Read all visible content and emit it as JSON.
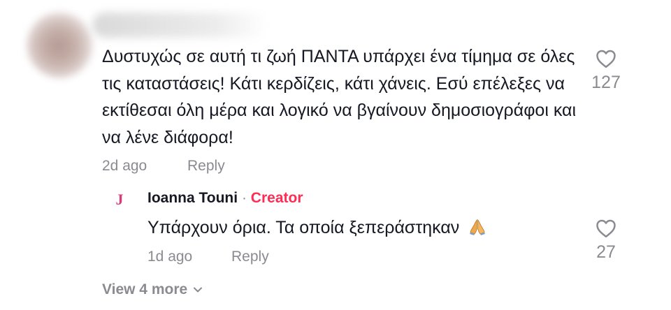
{
  "comment": {
    "text": "Δυστυχώς σε αυτή τι ζωή ΠΑΝΤΑ υπάρχει ένα τίμημα σε όλες τις καταστάσεις! Κάτι κερδίζεις, κάτι χάνεις. Εσύ επέλεξες να εκτίθεσαι όλη μέρα και λογικό να βγαίνουν δημοσιογράφοι και να λένε διάφορα!",
    "time": "2d ago",
    "reply_label": "Reply",
    "like_count": "127",
    "like_icon": "heart-outline-icon"
  },
  "reply": {
    "avatar_letter": "J",
    "author": "Ioanna Touni",
    "separator": "·",
    "badge": "Creator",
    "text": "Υπάρχουν όρια. Τα οποία ξεπεράστηκαν",
    "emoji_icon": "folded-hands-icon",
    "time": "1d ago",
    "reply_label": "Reply",
    "like_count": "27",
    "like_icon": "heart-outline-icon"
  },
  "view_more": {
    "label": "View 4 more",
    "icon": "chevron-down-icon"
  },
  "colors": {
    "text": "#161823",
    "secondary": "#8a8b91",
    "creator": "#fe2c55",
    "avatar_letter": "#d63c7a"
  }
}
